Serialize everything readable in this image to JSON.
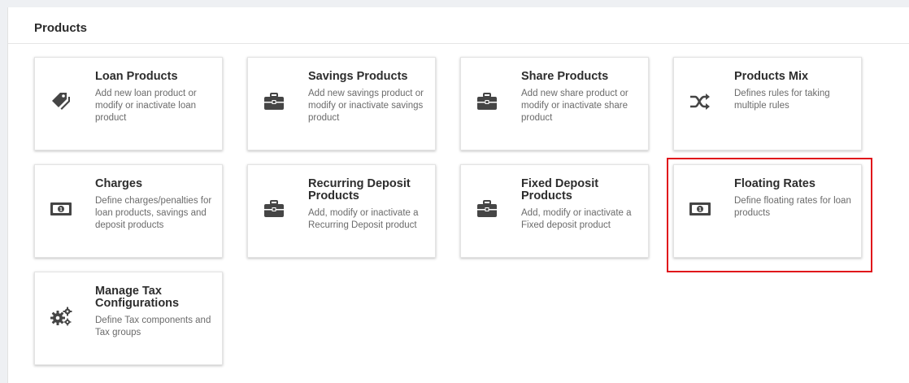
{
  "panel": {
    "title": "Products"
  },
  "cards": [
    {
      "title": "Loan Products",
      "description": "Add new loan product or modify or inactivate loan product",
      "icon": "tag-icon"
    },
    {
      "title": "Savings Products",
      "description": "Add new savings product or modify or inactivate savings product",
      "icon": "briefcase-icon"
    },
    {
      "title": "Share Products",
      "description": "Add new share product or modify or inactivate share product",
      "icon": "briefcase-icon"
    },
    {
      "title": "Products Mix",
      "description": "Defines rules for taking multiple rules",
      "icon": "shuffle-icon"
    },
    {
      "title": "Charges",
      "description": "Define charges/penalties for loan products, savings and deposit products",
      "icon": "money-bill-icon"
    },
    {
      "title": "Recurring Deposit Products",
      "description": "Add, modify or inactivate a Recurring Deposit product",
      "icon": "briefcase-icon"
    },
    {
      "title": "Fixed Deposit Products",
      "description": "Add, modify or inactivate a Fixed deposit product",
      "icon": "briefcase-icon"
    },
    {
      "title": "Floating Rates",
      "description": "Define floating rates for loan products",
      "icon": "money-bill-icon",
      "highlighted": true
    },
    {
      "title": "Manage Tax Configurations",
      "description": "Define Tax components and Tax groups",
      "icon": "cogs-icon"
    }
  ],
  "colors": {
    "icon": "#454545",
    "highlight_border": "#e0141b",
    "page_background": "#eef0f3"
  }
}
